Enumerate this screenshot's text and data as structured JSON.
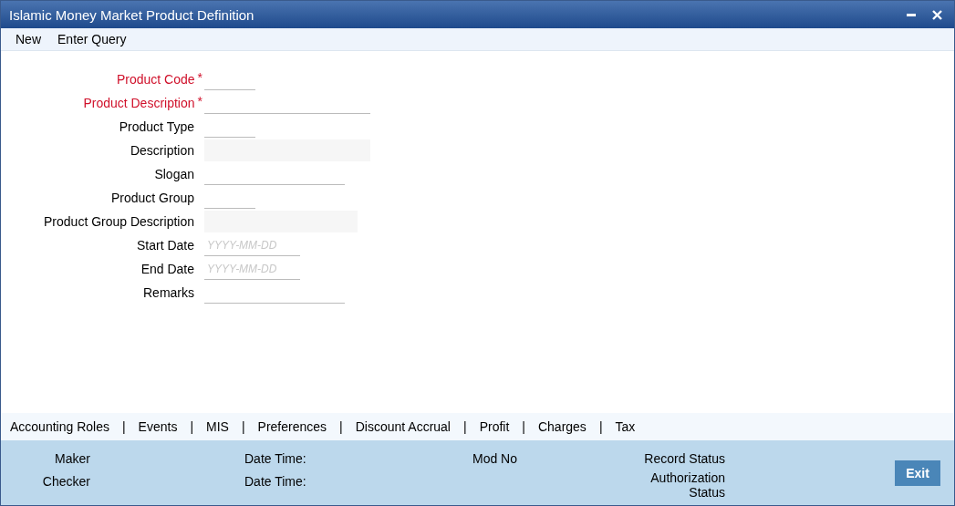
{
  "window": {
    "title": "Islamic Money Market Product Definition"
  },
  "menu": [
    "New",
    "Enter Query"
  ],
  "fields": [
    {
      "label": "Product Code",
      "required": true,
      "kind": "line"
    },
    {
      "label": "Product Description",
      "required": true,
      "kind": "line"
    },
    {
      "label": "Product Type",
      "required": false,
      "kind": "line"
    },
    {
      "label": "Description",
      "required": false,
      "kind": "readonly"
    },
    {
      "label": "Slogan",
      "required": false,
      "kind": "line"
    },
    {
      "label": "Product Group",
      "required": false,
      "kind": "line"
    },
    {
      "label": "Product Group Description",
      "required": false,
      "kind": "readonly"
    },
    {
      "label": "Start Date",
      "required": false,
      "kind": "line",
      "placeholder": "YYYY-MM-DD"
    },
    {
      "label": "End Date",
      "required": false,
      "kind": "line",
      "placeholder": "YYYY-MM-DD"
    },
    {
      "label": "Remarks",
      "required": false,
      "kind": "line"
    }
  ],
  "required_mark": "*",
  "subsystem_tabs": [
    "Accounting Roles",
    "Events",
    "MIS",
    "Preferences",
    "Discount Accrual",
    "Profit",
    "Charges",
    "Tax"
  ],
  "tab_separator": "|",
  "audit": {
    "maker": "Maker",
    "maker_date_time": "Date Time:",
    "mod_no": "Mod No",
    "record_status": "Record Status",
    "checker": "Checker",
    "checker_date_time": "Date Time:",
    "authorization_status": "Authorization Status"
  },
  "exit_button": "Exit"
}
